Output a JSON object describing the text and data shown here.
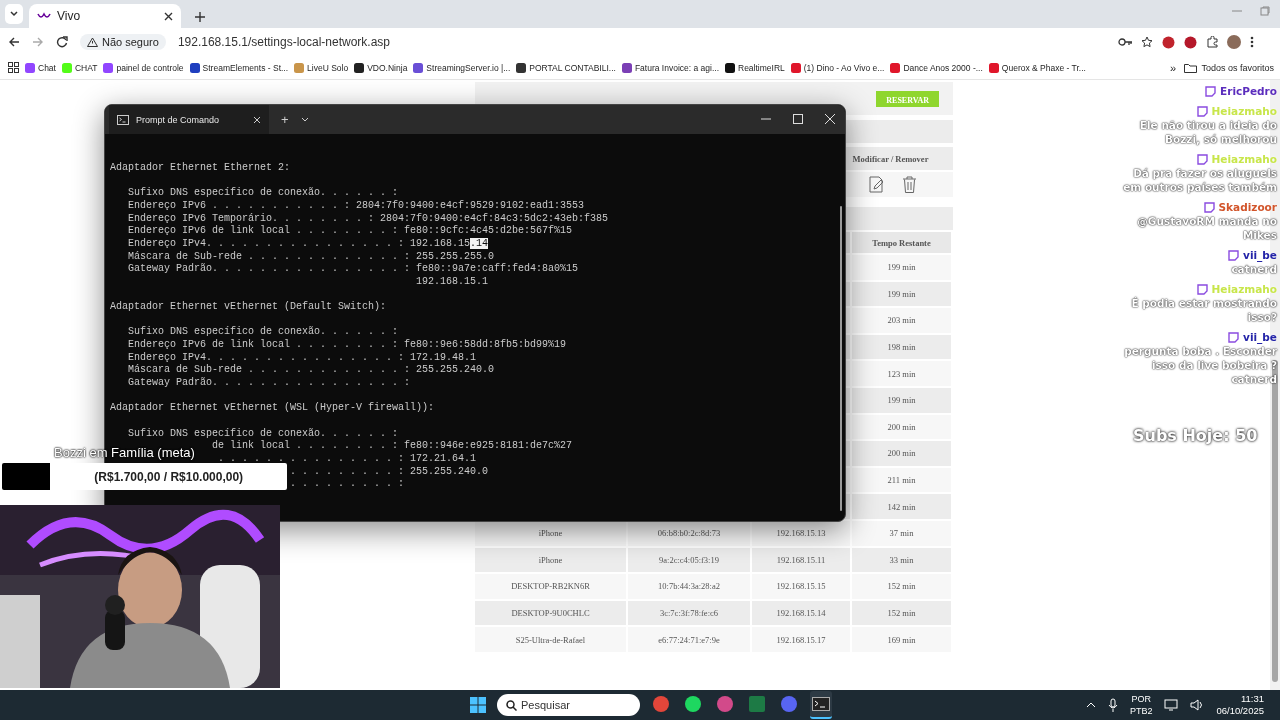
{
  "browser": {
    "tab": {
      "title": "Vivo",
      "selected": true
    },
    "address": {
      "security": "Não seguro",
      "url": "192.168.15.1/settings-local-network.asp"
    },
    "bookmarks": [
      {
        "label": "Chat",
        "color": "#9146ff"
      },
      {
        "label": "CHAT",
        "color": "#53fc18"
      },
      {
        "label": "painel de controle",
        "color": "#9146ff"
      },
      {
        "label": "StreamElements - St...",
        "color": "#1f3fbf"
      },
      {
        "label": "LiveU Solo",
        "color": "#c9954a"
      },
      {
        "label": "VDO.Ninja",
        "color": "#222222"
      },
      {
        "label": "StreamingServer.io |...",
        "color": "#6a4fd6"
      },
      {
        "label": "PORTAL CONTABILI...",
        "color": "#333333"
      },
      {
        "label": "Fatura Invoice: a agi...",
        "color": "#7b3fb5"
      },
      {
        "label": "RealtimeIRL",
        "color": "#111111"
      },
      {
        "label": "(1) Dino - Ao Vivo e...",
        "color": "#e0162b"
      },
      {
        "label": "Dance Anos 2000 -...",
        "color": "#e0162b"
      },
      {
        "label": "Querox & Phaxe - Tr...",
        "color": "#e0162b"
      }
    ],
    "more": "»",
    "all_bookmarks": "Todos os favoritos"
  },
  "router_page": {
    "reserve_button": "RESERVAR",
    "actions_header": "Modificar / Remover",
    "table": {
      "remaining_header": "Tempo Restante",
      "rows": [
        {
          "remaining": "199 min"
        },
        {
          "remaining": "199 min"
        },
        {
          "remaining": "203 min"
        },
        {
          "remaining": "198 min"
        },
        {
          "remaining": "123 min"
        },
        {
          "remaining": "199 min"
        },
        {
          "remaining": "200 min"
        },
        {
          "remaining": "200 min"
        },
        {
          "remaining": "211 min"
        },
        {
          "remaining": "142 min"
        },
        {
          "name": "iPhone",
          "mac": "06:b8:b0:2c:8d:73",
          "ip": "192.168.15.13",
          "remaining": "37 min"
        },
        {
          "name": "iPhone",
          "mac": "9a:2c:c4:05:f3:19",
          "ip": "192.168.15.11",
          "remaining": "33 min"
        },
        {
          "name": "DESKTOP-RB2KN6R",
          "mac": "10:7b:44:3a:28:a2",
          "ip": "192.168.15.15",
          "remaining": "152 min"
        },
        {
          "name": "DESKTOP-9U0CHLC",
          "mac": "3c:7c:3f:78:fe:c6",
          "ip": "192.168.15.14",
          "remaining": "152 min"
        },
        {
          "name": "S25-Ultra-de-Rafael",
          "mac": "e6:77:24:71:e7:9e",
          "ip": "192.168.15.17",
          "remaining": "169 min"
        }
      ]
    }
  },
  "terminal": {
    "title": "Prompt de Comando",
    "new_tab": "+",
    "adapters": [
      {
        "heading": "Adaptador Ethernet Ethernet 2:",
        "lines": [
          {
            "text": "   Sufixo DNS específico de conexão. . . . . . :"
          },
          {
            "text": "   Endereço IPv6 . . . . . . . . . . . : 2804:7f0:9400:e4cf:9529:9102:ead1:3553"
          },
          {
            "text": "   Endereço IPv6 Temporário. . . . . . . . : 2804:7f0:9400:e4cf:84c3:5dc2:43eb:f385"
          },
          {
            "text": "   Endereço IPv6 de link local . . . . . . . . : fe80::9cfc:4c45:d2be:567f%15"
          },
          {
            "text": "   Endereço IPv4. . . . . . . . . . . . . . . . : 192.168.15",
            "highlight": ".14"
          },
          {
            "text": "   Máscara de Sub-rede . . . . . . . . . . . . . : 255.255.255.0"
          },
          {
            "text": "   Gateway Padrão. . . . . . . . . . . . . . . . : fe80::9a7e:caff:fed4:8a0%15"
          },
          {
            "text": "                                                   192.168.15.1"
          }
        ]
      },
      {
        "heading": "Adaptador Ethernet vEthernet (Default Switch):",
        "lines": [
          {
            "text": "   Sufixo DNS específico de conexão. . . . . . :"
          },
          {
            "text": "   Endereço IPv6 de link local . . . . . . . . : fe80::9e6:58dd:8fb5:bd99%19"
          },
          {
            "text": "   Endereço IPv4. . . . . . . . . . . . . . . . : 172.19.48.1"
          },
          {
            "text": "   Máscara de Sub-rede . . . . . . . . . . . . . : 255.255.240.0"
          },
          {
            "text": "   Gateway Padrão. . . . . . . . . . . . . . . . :"
          }
        ]
      },
      {
        "heading": "Adaptador Ethernet vEthernet (WSL (Hyper-V firewall)):",
        "lines": [
          {
            "text": "   Sufixo DNS específico de conexão. . . . . . :"
          },
          {
            "text": "                 de link local . . . . . . . . : fe80::946e:e925:8181:de7c%27"
          },
          {
            "text": "                  . . . . . . . . . . . . . . . : 172.21.64.1"
          },
          {
            "text": "                              . . . . . . . . . : 255.255.240.0"
          },
          {
            "text": "                              . . . . . . . . . :"
          }
        ]
      }
    ]
  },
  "chat": [
    {
      "name": "EricPedro",
      "color": "#5b2dbd"
    },
    {
      "name": "Heiazmaho",
      "color": "#c8e64a",
      "message": "Ele não tirou a ideia do Bozzi, só melhorou"
    },
    {
      "name": "Heiazmaho",
      "color": "#c8e64a",
      "message": "Dá pra fazer os aluguels em outros países também"
    },
    {
      "name": "Skadizoor",
      "color": "#d2552b",
      "message": "@GustavoRM manda no Mikes"
    },
    {
      "name": "vii_be",
      "color": "#2424a8",
      "message": "catnerd"
    },
    {
      "name": "Heiazmaho",
      "color": "#c8e64a",
      "message": "É podia estar mostrando isso?"
    },
    {
      "name": "vii_be",
      "color": "#2424a8",
      "message": "pergunta boba . Esconder isso da live bobeira ? catnerd"
    }
  ],
  "subs_today": "Subs Hoje: 50",
  "goal": {
    "title": "Bozzi em Família (meta)",
    "amount": "(R$1.700,00 / R$10.000,00)",
    "level": 0.17
  },
  "taskbar": {
    "search": {
      "placeholder": "Pesquisar"
    },
    "language": "POR",
    "layout": "PTB2",
    "time": "11:31",
    "date": "06/10/2025"
  }
}
